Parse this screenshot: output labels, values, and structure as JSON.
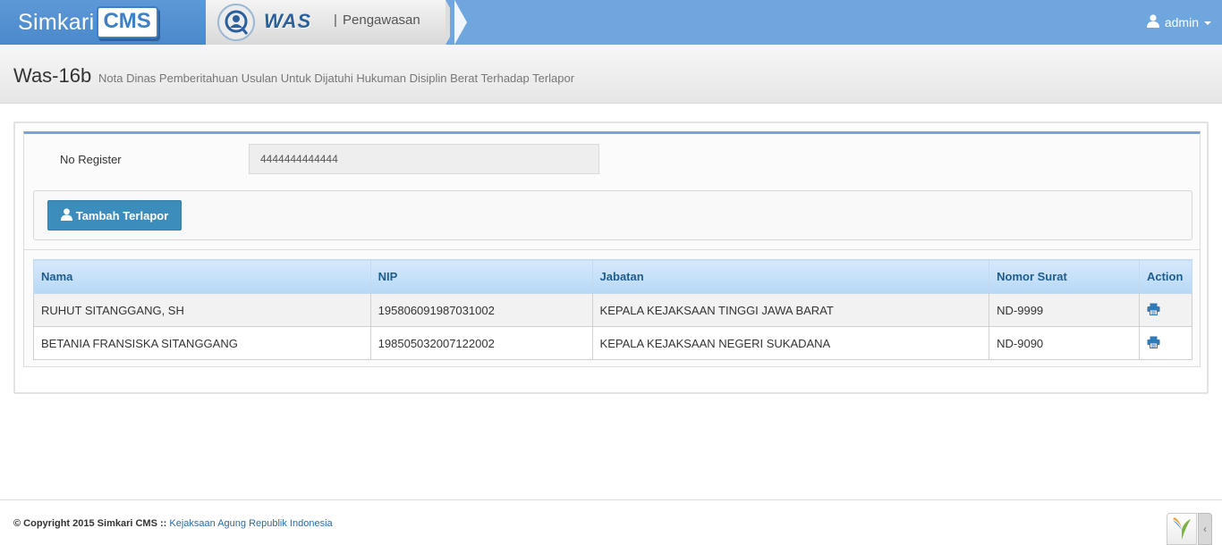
{
  "navbar": {
    "brand_simkari": "Simkari",
    "brand_cms": "CMS",
    "module_logo": "WAS",
    "module_separator": "|",
    "module_name": "Pengawasan",
    "user_name": "admin",
    "brand_color": "#4a89cc",
    "bar_color": "#6fa6dd"
  },
  "page": {
    "title": "Was-16b",
    "subtitle": "Nota Dinas Pemberitahuan Usulan Untuk Dijatuhi Hukuman Disiplin Berat Terhadap Terlapor"
  },
  "form": {
    "register_label": "No Register",
    "register_value": "4444444444444"
  },
  "actions": {
    "add_button_label": "Tambah Terlapor",
    "add_button_icon": "user-icon",
    "button_color": "#3c8dbc"
  },
  "table": {
    "columns": [
      "Nama",
      "NIP",
      "Jabatan",
      "Nomor Surat",
      "Action"
    ],
    "rows": [
      {
        "nama": "RUHUT SITANGGANG, SH",
        "nip": "195806091987031002",
        "jabatan": "KEPALA KEJAKSAAN TINGGI JAWA BARAT",
        "nomor_surat": "ND-9999",
        "action_icon": "print-icon"
      },
      {
        "nama": "BETANIA FRANSISKA SITANGGANG",
        "nip": "198505032007122002",
        "jabatan": "KEPALA KEJAKSAAN NEGERI SUKADANA",
        "nomor_surat": "ND-9090",
        "action_icon": "print-icon"
      }
    ]
  },
  "footer": {
    "copyright": "© Copyright 2015 Simkari CMS",
    "separator": " :: ",
    "link_text": "Kejaksaan Agung Republik Indonesia"
  }
}
